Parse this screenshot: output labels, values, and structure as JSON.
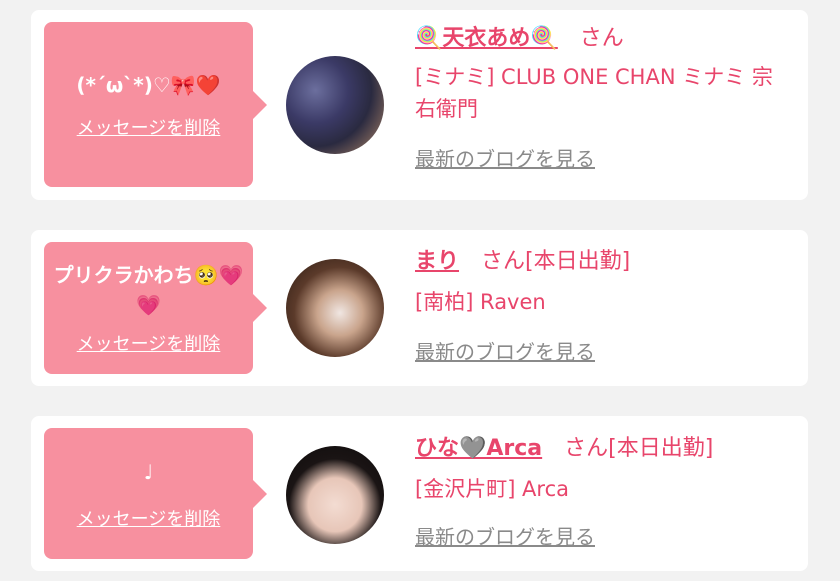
{
  "messages": [
    {
      "message_text": "(*´ω`*)♡🎀❤️",
      "delete_label": "メッセージを削除",
      "name": "🍭天衣あめ🍭",
      "honorific": "さん",
      "status": "",
      "shop": "[ミナミ] CLUB ONE CHAN ミナミ 宗右衛門",
      "blog_label": "最新のブログを見る"
    },
    {
      "message_text": "プリクラかわち🥺💗💗",
      "delete_label": "メッセージを削除",
      "name": "まり",
      "honorific": "さん",
      "status": "[本日出勤]",
      "shop": "[南柏] Raven",
      "blog_label": "最新のブログを見る"
    },
    {
      "message_text": "♩",
      "delete_label": "メッセージを削除",
      "name": "ひな🩶Arca",
      "honorific": "さん",
      "status": "[本日出勤]",
      "shop": "[金沢片町] Arca",
      "blog_label": "最新のブログを見る"
    }
  ],
  "colors": {
    "bubble": "#f7909f",
    "accent": "#e8456b",
    "link_gray": "#8a8a8a"
  }
}
